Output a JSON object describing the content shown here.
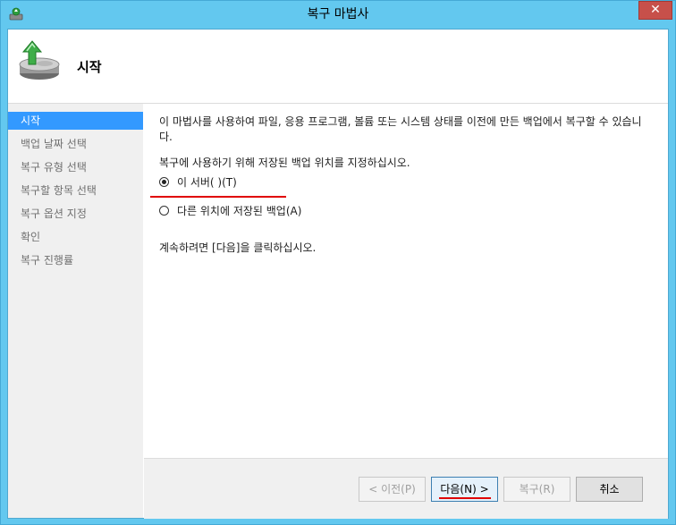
{
  "window": {
    "title": "복구 마법사",
    "close_label": "✕"
  },
  "header": {
    "title": "시작",
    "icon": "backup-drive-icon"
  },
  "nav": {
    "items": [
      {
        "label": "시작",
        "active": true
      },
      {
        "label": "백업 날짜 선택",
        "active": false
      },
      {
        "label": "복구 유형 선택",
        "active": false
      },
      {
        "label": "복구할 항목 선택",
        "active": false
      },
      {
        "label": "복구 옵션 지정",
        "active": false
      },
      {
        "label": "확인",
        "active": false
      },
      {
        "label": "복구 진행률",
        "active": false
      }
    ]
  },
  "content": {
    "intro": "이 마법사를 사용하여 파일, 응용 프로그램, 볼륨 또는 시스템 상태를 이전에 만든 백업에서 복구할 수 있습니다.",
    "instruction": "복구에 사용하기 위해 저장된 백업 위치를 지정하십시오.",
    "options": [
      {
        "label": "이 서버(            )(T)",
        "selected": true
      },
      {
        "label": "다른 위치에 저장된 백업(A)",
        "selected": false
      }
    ],
    "continue_text": "계속하려면 [다음]을 클릭하십시오."
  },
  "buttons": {
    "prev": "< 이전(P)",
    "next": "다음(N) >",
    "recover": "복구(R)",
    "cancel": "취소"
  },
  "colors": {
    "title_bar": "#63c8ef",
    "nav_active": "#3399ff",
    "highlight": "#e00000"
  }
}
